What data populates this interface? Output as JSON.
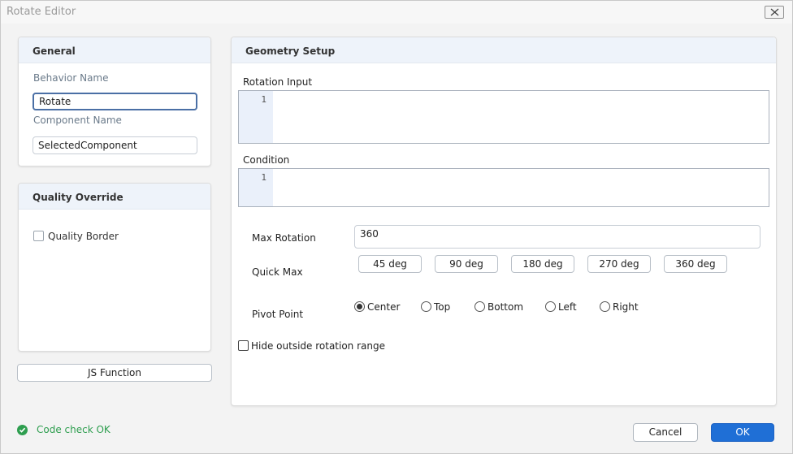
{
  "window": {
    "title": "Rotate Editor",
    "close_icon": "close-icon"
  },
  "general": {
    "title": "General",
    "behavior_name_label": "Behavior Name",
    "behavior_name_value": "Rotate",
    "component_name_label": "Component Name",
    "component_name_value": "SelectedComponent"
  },
  "quality": {
    "title": "Quality Override",
    "border_label": "Quality Border",
    "border_checked": false
  },
  "js_function_label": "JS Function",
  "geometry": {
    "title": "Geometry Setup",
    "rotation_input_label": "Rotation Input",
    "rotation_input_line": "1",
    "condition_label": "Condition",
    "condition_line": "1",
    "max_rotation_label": "Max Rotation",
    "max_rotation_value": "360",
    "quick_max_label": "Quick Max",
    "quick_max_buttons": [
      "45 deg",
      "90 deg",
      "180 deg",
      "270 deg",
      "360 deg"
    ],
    "pivot_label": "Pivot Point",
    "pivot_options": [
      "Center",
      "Top",
      "Bottom",
      "Left",
      "Right"
    ],
    "pivot_selected": "Center",
    "hide_outside_label": "Hide outside rotation range",
    "hide_outside_checked": false
  },
  "status": {
    "text": "Code check OK",
    "color": "#2e9e4f"
  },
  "footer": {
    "cancel_label": "Cancel",
    "ok_label": "OK"
  },
  "colors": {
    "accent": "#1f6fd6",
    "panel_header": "#eef3fa"
  }
}
